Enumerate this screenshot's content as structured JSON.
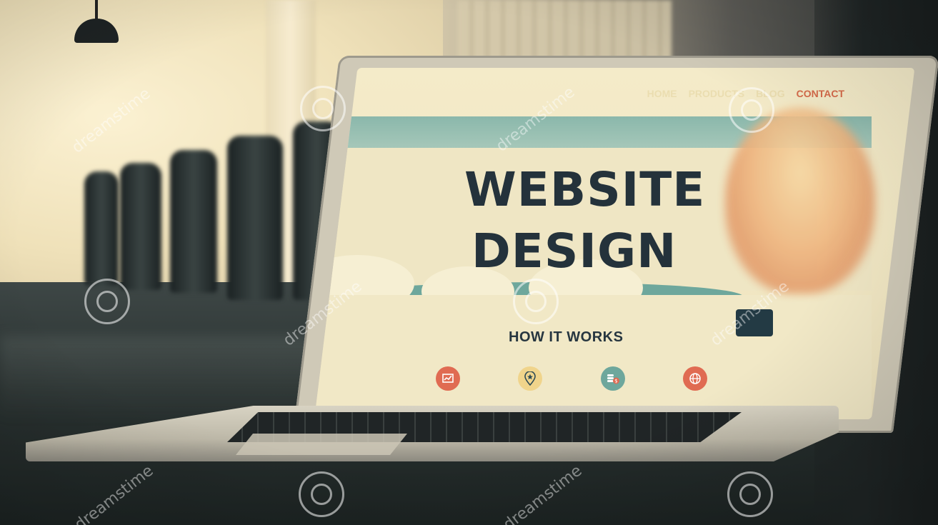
{
  "screen": {
    "nav": [
      {
        "label": "HOME"
      },
      {
        "label": "PRODUCTS"
      },
      {
        "label": "BLOG"
      },
      {
        "label": "CONTACT",
        "active": true
      }
    ],
    "title_line1": "WEBSITE",
    "title_line2": "DESIGN",
    "section_heading": "HOW IT WORKS",
    "icons": [
      "chart-icon",
      "location-star-icon",
      "coins-dollar-icon",
      "globe-icon"
    ]
  },
  "watermark": {
    "brand": "dreamstime",
    "icon": "spiral-icon"
  },
  "colors": {
    "accent_contact": "#d56a4a",
    "title_text": "#24323b",
    "teal": "#6ea79c",
    "orange": "#e06b52"
  }
}
